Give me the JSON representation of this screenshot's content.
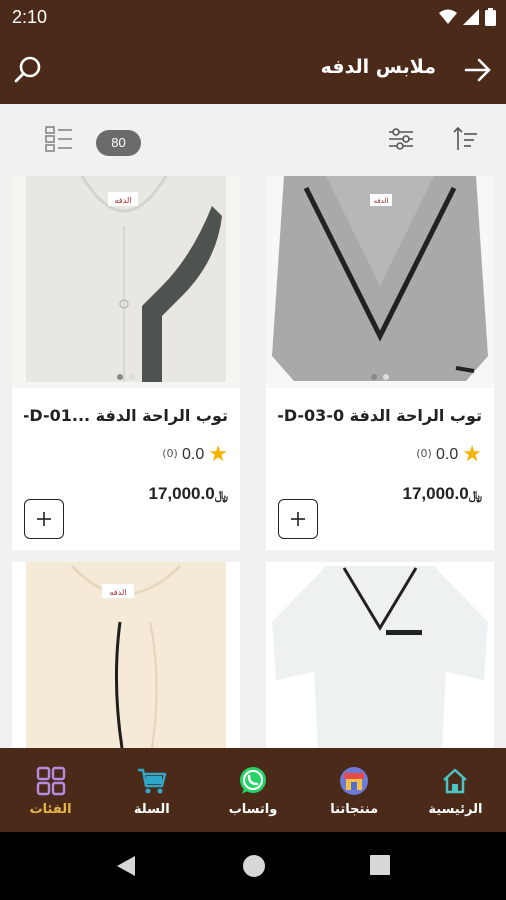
{
  "status_bar": {
    "time": "2:10"
  },
  "app_bar": {
    "title": "ملابس الدفه"
  },
  "toolbar": {
    "count": "80"
  },
  "products": [
    {
      "title": "توب الراحة الدفة C-D-03-0",
      "rating": "0.0",
      "reviews": "(0)",
      "price": "17,000.0",
      "currency": "﷼"
    },
    {
      "title": "توب الراحة الدفة ...C-D-01-",
      "rating": "0.0",
      "reviews": "(0)",
      "price": "17,000.0",
      "currency": "﷼"
    },
    {
      "title": "",
      "rating": "",
      "reviews": "",
      "price": "",
      "currency": ""
    },
    {
      "title": "",
      "rating": "",
      "reviews": "",
      "price": "",
      "currency": ""
    }
  ],
  "bottom_nav": {
    "items": [
      {
        "label": "الرئيسية",
        "icon": "home-icon"
      },
      {
        "label": "منتجاتنا",
        "icon": "shop-icon"
      },
      {
        "label": "واتساب",
        "icon": "whatsapp-icon"
      },
      {
        "label": "السلة",
        "icon": "cart-icon"
      },
      {
        "label": "الفئات",
        "icon": "categories-icon"
      }
    ]
  },
  "colors": {
    "brand": "#4c2a1a",
    "accent": "#e6b54a",
    "star": "#f5b301"
  }
}
